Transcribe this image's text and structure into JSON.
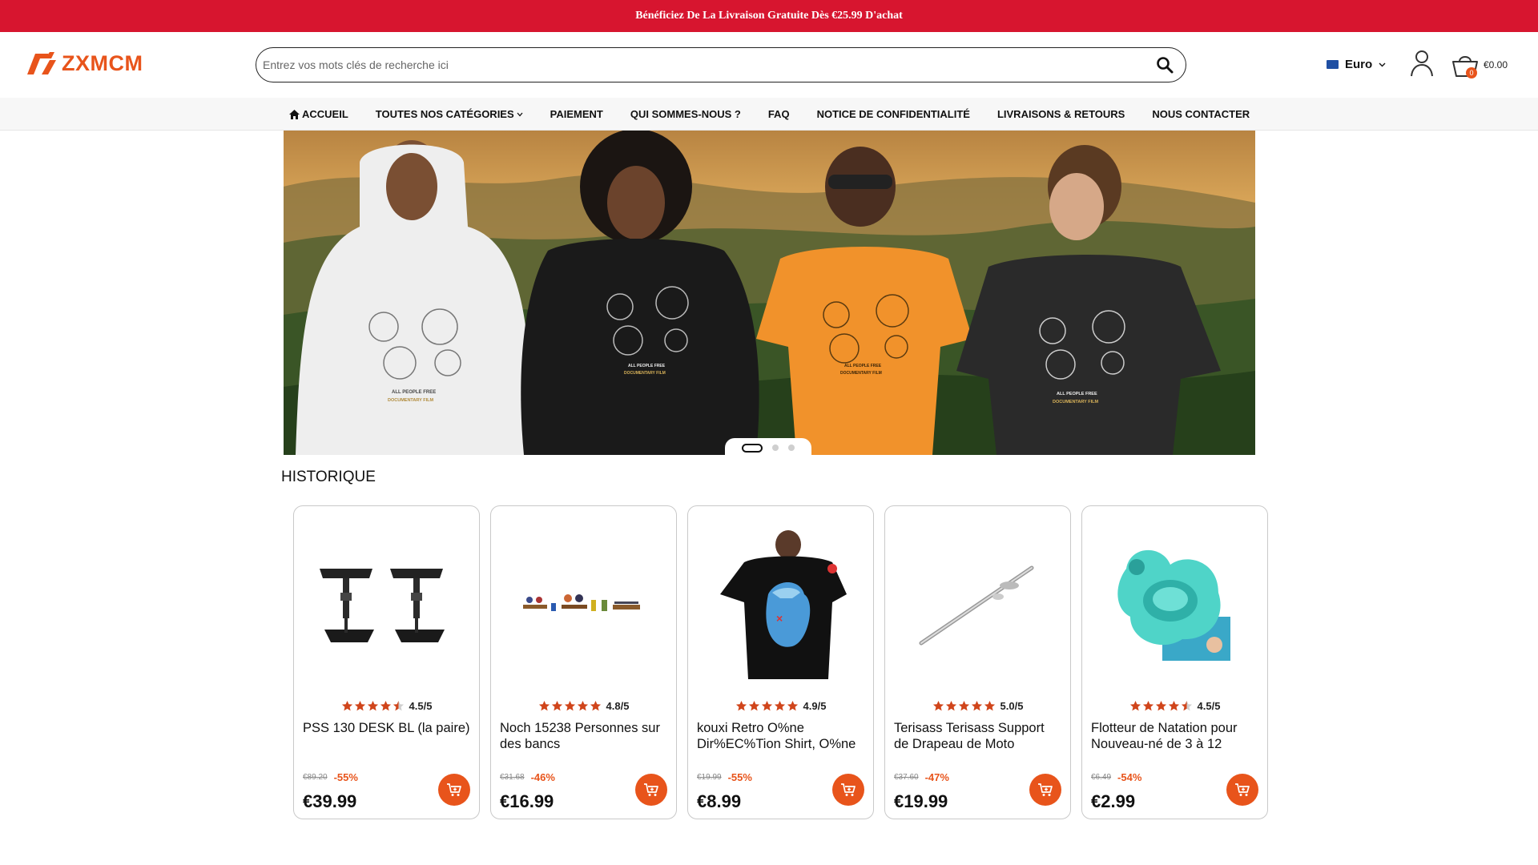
{
  "promo": {
    "text": "Bénéficiez De La Livraison Gratuite Dès €25.99 D'achat"
  },
  "header": {
    "logo_text": "ZXMCM",
    "search": {
      "placeholder": "Entrez vos mots clés de recherche ici",
      "value": ""
    },
    "currency": "Euro",
    "cart": {
      "count": "0",
      "total": "€0.00"
    }
  },
  "nav": {
    "items": [
      {
        "label": "ACCUEIL",
        "icon": "home-icon"
      },
      {
        "label": "TOUTES NOS CATÉGORIES",
        "icon": "chevron-down-icon"
      },
      {
        "label": "PAIEMENT"
      },
      {
        "label": "QUI SOMMES-NOUS ?"
      },
      {
        "label": "FAQ"
      },
      {
        "label": "NOTICE DE CONFIDENTIALITÉ"
      },
      {
        "label": "LIVRAISONS & RETOURS"
      },
      {
        "label": "NOUS CONTACTER"
      }
    ]
  },
  "hero": {
    "print_lines": [
      "ALL PEOPLE FREE",
      "DOCUMENTARY FILM"
    ],
    "slide_count": 3,
    "active_slide": 1
  },
  "section": {
    "title": "HISTORIQUE"
  },
  "products": [
    {
      "rating": "4.5/5",
      "stars": 4.5,
      "title": "PSS 130 DESK BL (la paire)",
      "old_price": "€89.20",
      "discount": "-55%",
      "price": "€39.99"
    },
    {
      "rating": "4.8/5",
      "stars": 5,
      "title": "Noch 15238 Personnes sur des bancs",
      "old_price": "€31.68",
      "discount": "-46%",
      "price": "€16.99"
    },
    {
      "rating": "4.9/5",
      "stars": 5,
      "title": "kouxi Retro O%ne Dir%EC%Tion Shirt, O%ne",
      "old_price": "€19.99",
      "discount": "-55%",
      "price": "€8.99"
    },
    {
      "rating": "5.0/5",
      "stars": 5,
      "title": "Terisass Terisass Support de Drapeau de Moto",
      "old_price": "€37.60",
      "discount": "-47%",
      "price": "€19.99"
    },
    {
      "rating": "4.5/5",
      "stars": 4.5,
      "title": "Flotteur de Natation pour Nouveau-né de 3 à 12",
      "old_price": "€6.49",
      "discount": "-54%",
      "price": "€2.99"
    }
  ],
  "colors": {
    "promo_bg": "#d7152f",
    "accent": "#e8541b",
    "star": "#d0451b"
  }
}
